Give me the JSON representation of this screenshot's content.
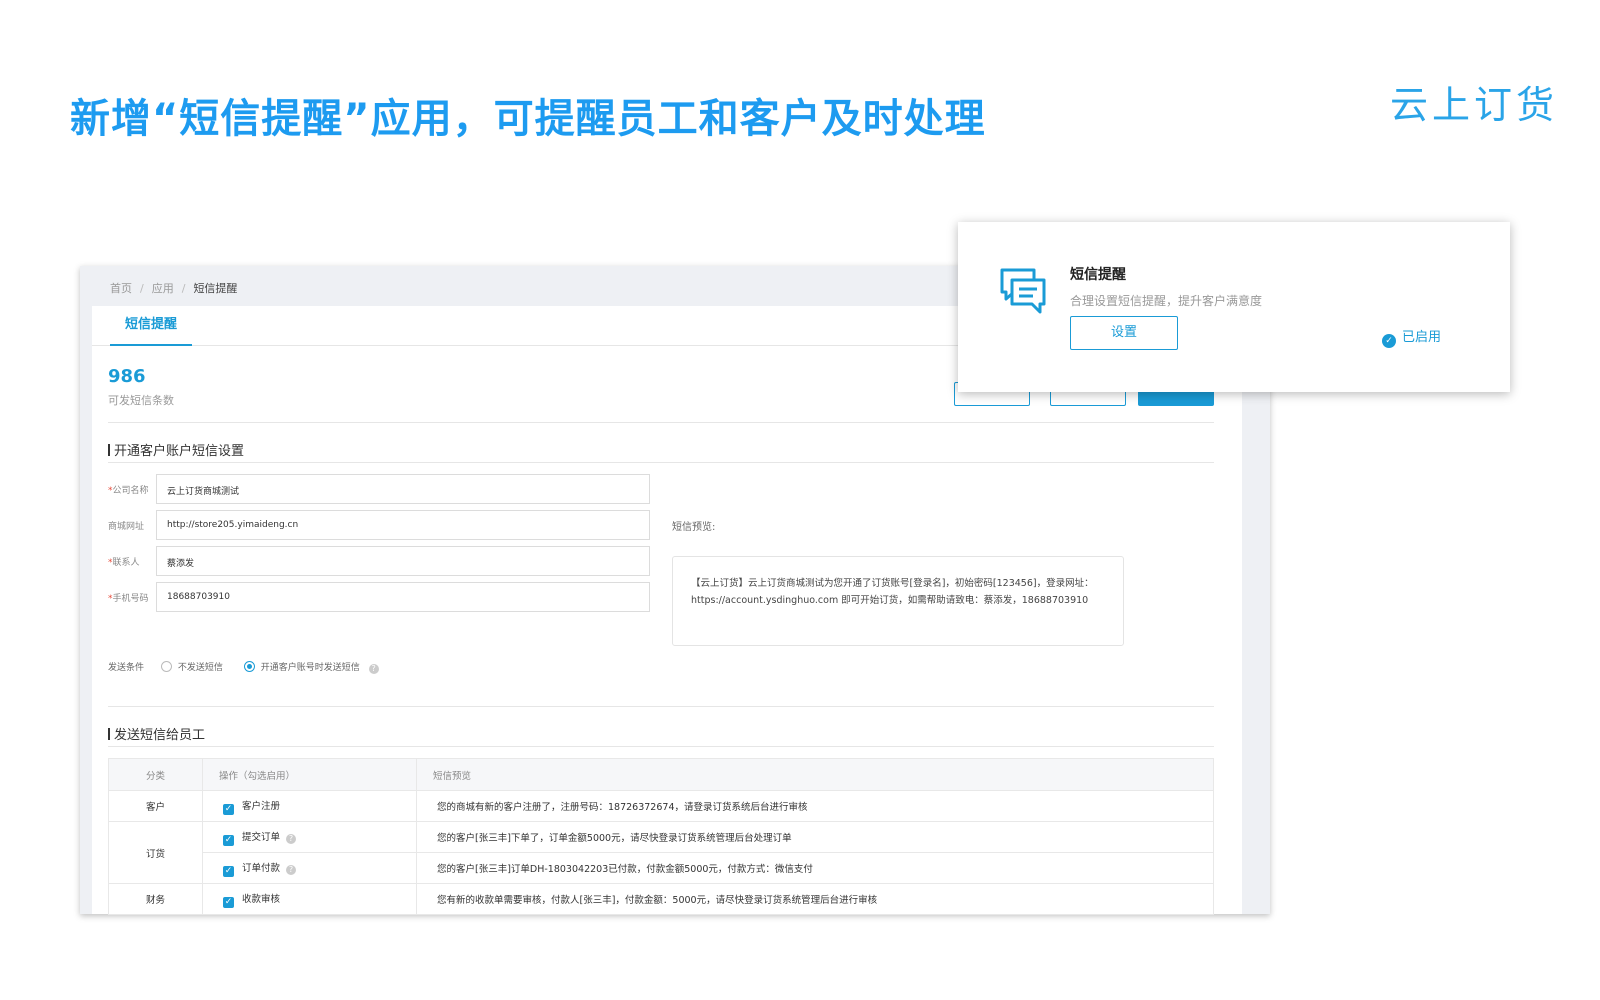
{
  "headline": "新增“短信提醒”应用，可提醒员工和客户及时处理",
  "brand": "云上订货",
  "colors": {
    "accent": "#1a9bd6",
    "headline": "#1d9bf0"
  },
  "breadcrumb": {
    "home": "首页",
    "sep": "/",
    "apps": "应用",
    "current": "短信提醒"
  },
  "tab": "短信提醒",
  "sms_count": {
    "value": "986",
    "label": "可发短信条数"
  },
  "customer_section": {
    "title": "开通客户账户短信设置",
    "fields": [
      {
        "label": "公司名称",
        "required": true,
        "value": "云上订货商城测试"
      },
      {
        "label": "商城网址",
        "required": false,
        "value": "http://store205.yimaideng.cn"
      },
      {
        "label": "联系人",
        "required": true,
        "value": "蔡添发"
      },
      {
        "label": "手机号码",
        "required": true,
        "value": "18688703910"
      }
    ],
    "send_condition": {
      "label": "发送条件",
      "options": [
        {
          "label": "不发送短信",
          "selected": false
        },
        {
          "label": "开通客户账号时发送短信",
          "selected": true
        }
      ]
    },
    "preview_label": "短信预览:",
    "preview_text": "【云上订货】云上订货商城测试为您开通了订货账号[登录名]，初始密码[123456]，登录网址：https://account.ysdinghuo.com 即可开始订货，如需帮助请致电：蔡添发，18688703910"
  },
  "staff_section": {
    "title": "发送短信给员工",
    "headers": [
      "分类",
      "操作（勾选启用）",
      "短信预览"
    ],
    "groups": [
      {
        "category": "客户",
        "items": [
          {
            "label": "客户注册",
            "checked": true,
            "help": false,
            "preview": "您的商城有新的客户注册了，注册号码：18726372674，请登录订货系统后台进行审核"
          }
        ]
      },
      {
        "category": "订货",
        "items": [
          {
            "label": "提交订单",
            "checked": true,
            "help": true,
            "preview": "您的客户[张三丰]下单了，订单金额5000元，请尽快登录订货系统管理后台处理订单"
          },
          {
            "label": "订单付款",
            "checked": true,
            "help": true,
            "preview": "您的客户[张三丰]订单DH-1803042203已付款，付款金额5000元，付款方式：微信支付"
          }
        ]
      },
      {
        "category": "财务",
        "items": [
          {
            "label": "收款审核",
            "checked": true,
            "help": false,
            "preview": "您有新的收款单需要审核，付款人[张三丰]，付款金额：5000元，请尽快登录订货系统管理后台进行审核"
          }
        ]
      }
    ]
  },
  "app_card": {
    "icon": "chat-bubbles-icon",
    "title": "短信提醒",
    "description": "合理设置短信提醒，提升客户满意度",
    "button": "设置",
    "status": "已启用"
  }
}
